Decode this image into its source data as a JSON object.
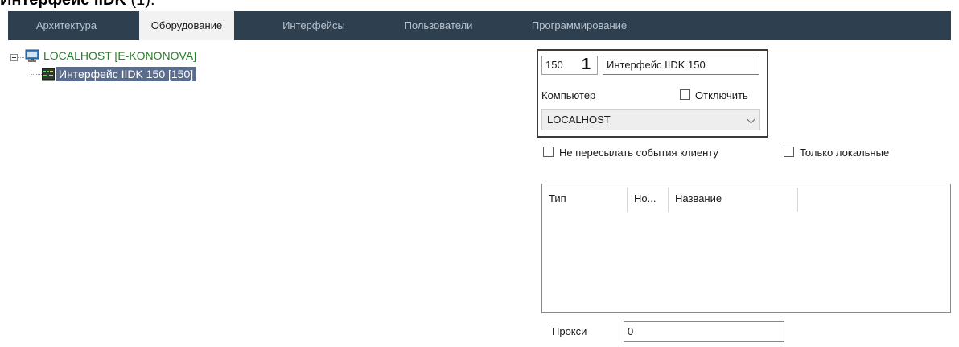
{
  "caption": {
    "bold_part": "Интерфейс IIDK",
    "rest": " (1)."
  },
  "tabs": [
    {
      "label": "Архитектура",
      "active": false
    },
    {
      "label": "Оборудование",
      "active": true
    },
    {
      "label": "Интерфейсы",
      "active": false
    },
    {
      "label": "Пользователи",
      "active": false
    },
    {
      "label": "Программирование",
      "active": false
    }
  ],
  "tree": {
    "host": {
      "label": "LOCALHOST [E-KONONOVA]",
      "icon": "computer-icon"
    },
    "device": {
      "label": "Интерфейс IIDK 150 [150]",
      "icon": "iidk-device-icon",
      "selected": true
    }
  },
  "settings": {
    "id_value": "150",
    "marker": "1",
    "name_value": "Интерфейс IIDK 150",
    "computer_label": "Компьютер",
    "disable_label": "Отключить",
    "disable_checked": false,
    "computer_value": "LOCALHOST",
    "no_forward_label": "Не пересылать события клиенту",
    "no_forward_checked": false,
    "local_only_label": "Только локальные",
    "local_only_checked": false
  },
  "table": {
    "columns": [
      "Тип",
      "Но...",
      "Название"
    ],
    "rows": []
  },
  "proxy": {
    "label": "Прокси",
    "value": "0"
  },
  "colors": {
    "tabbar_bg": "#2e3f4f",
    "host_label": "#2a7d2a",
    "selection_bg": "#5b6d8f"
  }
}
